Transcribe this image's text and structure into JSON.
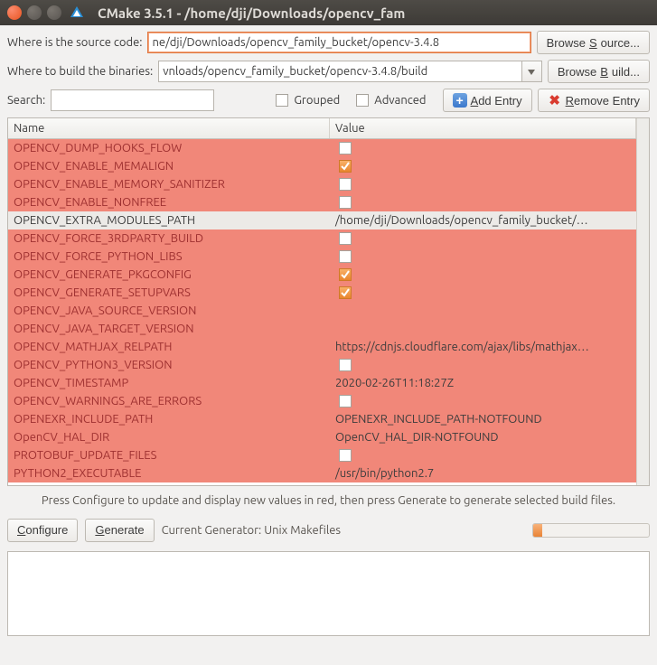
{
  "window": {
    "title": "CMake 3.5.1 - /home/dji/Downloads/opencv_fam"
  },
  "labels": {
    "source": "Where is the source code:",
    "build": "Where to build the binaries:",
    "search": "Search:",
    "grouped": "Grouped",
    "advanced": "Advanced",
    "browse_source_pre": "Browse ",
    "browse_source_u": "S",
    "browse_source_post": "ource...",
    "browse_build_pre": "Browse ",
    "browse_build_u": "B",
    "browse_build_post": "uild...",
    "add_entry_u": "A",
    "add_entry_post": "dd Entry",
    "remove_entry_u": "R",
    "remove_entry_post": "emove Entry",
    "col_name": "Name",
    "col_value": "Value",
    "hint": "Press Configure to update and display new values in red, then press Generate to generate selected build files.",
    "configure_u": "C",
    "configure_post": "onfigure",
    "generate_u": "G",
    "generate_post": "enerate",
    "current_gen": "Current Generator: Unix Makefiles"
  },
  "inputs": {
    "source": "ne/dji/Downloads/opencv_family_bucket/opencv-3.4.8",
    "build": "vnloads/opencv_family_bucket/opencv-3.4.8/build",
    "search": ""
  },
  "rows": [
    {
      "name": "OPENCV_DUMP_HOOKS_FLOW",
      "type": "check",
      "checked": false
    },
    {
      "name": "OPENCV_ENABLE_MEMALIGN",
      "type": "check",
      "checked": true
    },
    {
      "name": "OPENCV_ENABLE_MEMORY_SANITIZER",
      "type": "check",
      "checked": false
    },
    {
      "name": "OPENCV_ENABLE_NONFREE",
      "type": "check",
      "checked": false
    },
    {
      "name": "OPENCV_EXTRA_MODULES_PATH",
      "type": "text",
      "value": "/home/dji/Downloads/opencv_family_bucket/…",
      "selected": true
    },
    {
      "name": "OPENCV_FORCE_3RDPARTY_BUILD",
      "type": "check",
      "checked": false
    },
    {
      "name": "OPENCV_FORCE_PYTHON_LIBS",
      "type": "check",
      "checked": false
    },
    {
      "name": "OPENCV_GENERATE_PKGCONFIG",
      "type": "check",
      "checked": true
    },
    {
      "name": "OPENCV_GENERATE_SETUPVARS",
      "type": "check",
      "checked": true
    },
    {
      "name": "OPENCV_JAVA_SOURCE_VERSION",
      "type": "text",
      "value": ""
    },
    {
      "name": "OPENCV_JAVA_TARGET_VERSION",
      "type": "text",
      "value": ""
    },
    {
      "name": "OPENCV_MATHJAX_RELPATH",
      "type": "text",
      "value": "https://cdnjs.cloudflare.com/ajax/libs/mathjax…"
    },
    {
      "name": "OPENCV_PYTHON3_VERSION",
      "type": "check",
      "checked": false
    },
    {
      "name": "OPENCV_TIMESTAMP",
      "type": "text",
      "value": "2020-02-26T11:18:27Z"
    },
    {
      "name": "OPENCV_WARNINGS_ARE_ERRORS",
      "type": "check",
      "checked": false
    },
    {
      "name": "OPENEXR_INCLUDE_PATH",
      "type": "text",
      "value": "OPENEXR_INCLUDE_PATH-NOTFOUND"
    },
    {
      "name": "OpenCV_HAL_DIR",
      "type": "text",
      "value": "OpenCV_HAL_DIR-NOTFOUND"
    },
    {
      "name": "PROTOBUF_UPDATE_FILES",
      "type": "check",
      "checked": false
    },
    {
      "name": "PYTHON2_EXECUTABLE",
      "type": "text",
      "value": "/usr/bin/python2.7"
    }
  ]
}
